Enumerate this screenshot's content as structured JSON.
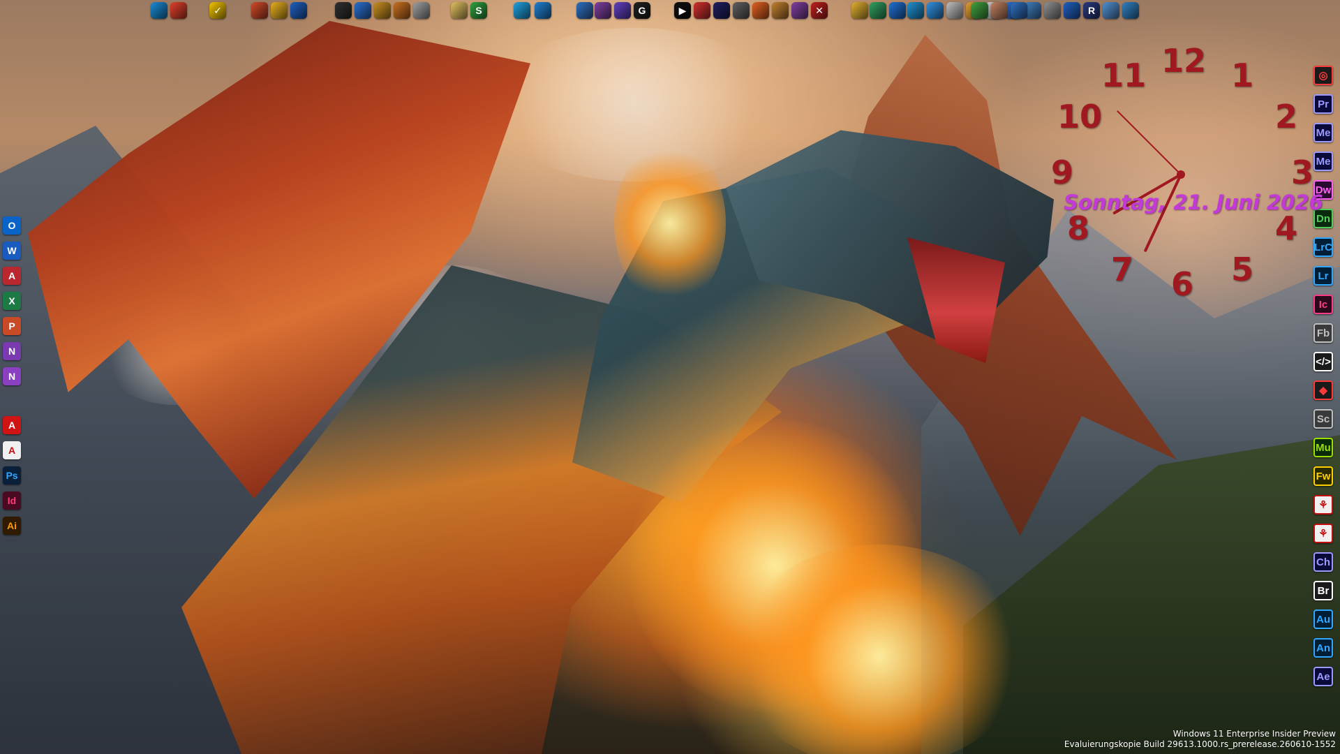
{
  "desktop": {
    "wallpaper_subject": "",
    "watermark": {
      "line1": "Windows 11 Enterprise Insider Preview",
      "line2": "Evaluierungskopie Build 29613.1000.rs_prerelease.260610-1552"
    }
  },
  "clock_widget": {
    "numbers": [
      "12",
      "1",
      "2",
      "3",
      "4",
      "5",
      "6",
      "7",
      "8",
      "9",
      "10",
      "11"
    ],
    "date": "Sonntag, 21. Juni 2026",
    "hour_hand_angle": 240,
    "minute_hand_angle": 205,
    "second_hand_angle": 315,
    "accent_color": "#a01820",
    "date_color": "#c23ad8"
  },
  "top_bar_icons": [
    {
      "name": "edge-icon",
      "label": "",
      "color": "#1a8ad4"
    },
    {
      "name": "chrome-icon",
      "label": "",
      "color": "#e0402a"
    },
    {
      "name": "tasks-icon",
      "label": "✓",
      "color": "#f2c400"
    },
    {
      "name": "app-icon-1",
      "label": "",
      "color": "#d04a2a"
    },
    {
      "name": "app-icon-2",
      "label": "",
      "color": "#e8b020"
    },
    {
      "name": "app-icon-3",
      "label": "",
      "color": "#2060c0"
    },
    {
      "name": "app-icon-4",
      "label": "",
      "color": "#303030"
    },
    {
      "name": "app-icon-5",
      "label": "",
      "color": "#2a70d0"
    },
    {
      "name": "app-icon-6",
      "label": "",
      "color": "#c89020"
    },
    {
      "name": "app-icon-7",
      "label": "",
      "color": "#c87020"
    },
    {
      "name": "app-icon-8",
      "label": "",
      "color": "#a0a0a0"
    },
    {
      "name": "app-icon-9",
      "label": "",
      "color": "#e0c060"
    },
    {
      "name": "app-icon-10",
      "label": "S",
      "color": "#30a040"
    },
    {
      "name": "app-icon-11",
      "label": "",
      "color": "#20a0e0"
    },
    {
      "name": "app-icon-12",
      "label": "",
      "color": "#2080d0"
    },
    {
      "name": "app-icon-13",
      "label": "",
      "color": "#3070c0"
    },
    {
      "name": "app-icon-14",
      "label": "",
      "color": "#8040a0"
    },
    {
      "name": "app-icon-15",
      "label": "",
      "color": "#6040c0"
    },
    {
      "name": "app-icon-16",
      "label": "G",
      "color": "#202020"
    },
    {
      "name": "app-icon-17",
      "label": "▶",
      "color": "#101010"
    },
    {
      "name": "app-icon-18",
      "label": "",
      "color": "#d03030"
    },
    {
      "name": "app-icon-19",
      "label": "",
      "color": "#202060"
    },
    {
      "name": "app-icon-20",
      "label": "",
      "color": "#606060"
    },
    {
      "name": "app-icon-21",
      "label": "",
      "color": "#e06020"
    },
    {
      "name": "app-icon-22",
      "label": "",
      "color": "#c08030"
    },
    {
      "name": "app-icon-23",
      "label": "",
      "color": "#8040a0"
    },
    {
      "name": "app-icon-24",
      "label": "✕",
      "color": "#c02020"
    },
    {
      "name": "app-icon-25",
      "label": "",
      "color": "#e0b030"
    },
    {
      "name": "app-icon-26",
      "label": "",
      "color": "#30a060"
    },
    {
      "name": "app-icon-27",
      "label": "",
      "color": "#2070d0"
    },
    {
      "name": "app-icon-28",
      "label": "",
      "color": "#2090d0"
    },
    {
      "name": "app-icon-29",
      "label": "",
      "color": "#3090e0"
    },
    {
      "name": "app-icon-30",
      "label": "",
      "color": "#c0c0c0"
    },
    {
      "name": "app-icon-31",
      "label": "",
      "color": "#e0a030"
    },
    {
      "name": "app-icon-32",
      "label": "",
      "color": "#d0d0d0"
    },
    {
      "name": "app-icon-33",
      "label": "",
      "color": "#3070d0"
    },
    {
      "name": "app-icon-34",
      "label": "",
      "color": "#4080c0"
    },
    {
      "name": "app-icon-35",
      "label": "",
      "color": "#909090"
    },
    {
      "name": "app-icon-36",
      "label": "",
      "color": "#2060c0"
    },
    {
      "name": "app-icon-37",
      "label": "R",
      "color": "#2a3a80"
    },
    {
      "name": "app-icon-38",
      "label": "",
      "color": "#5090d0"
    },
    {
      "name": "app-icon-39",
      "label": "",
      "color": "#3080c0"
    },
    {
      "name": "app-icon-40",
      "label": "",
      "color": "#40a040"
    },
    {
      "name": "app-icon-41",
      "label": "",
      "color": "#c08060"
    },
    {
      "name": "app-icon-42",
      "label": "",
      "color": "#3070c0"
    }
  ],
  "left_dock": [
    {
      "name": "outlook-icon",
      "label": "O",
      "color": "#0a64c8",
      "fg": "#ffffff"
    },
    {
      "name": "word-icon",
      "label": "W",
      "color": "#1a5bbf",
      "fg": "#ffffff"
    },
    {
      "name": "access-icon",
      "label": "A",
      "color": "#b8282e",
      "fg": "#ffffff"
    },
    {
      "name": "excel-icon",
      "label": "X",
      "color": "#1d7a44",
      "fg": "#ffffff"
    },
    {
      "name": "powerpoint-icon",
      "label": "P",
      "color": "#c84a26",
      "fg": "#ffffff"
    },
    {
      "name": "onenote-icon",
      "label": "N",
      "color": "#7a3bb0",
      "fg": "#ffffff"
    },
    {
      "name": "onenote-2-icon",
      "label": "N",
      "color": "#8a40c0",
      "fg": "#ffffff"
    },
    {
      "name": "acrobat-icon",
      "label": "A",
      "color": "#d01414",
      "fg": "#ffffff"
    },
    {
      "name": "acrobat-reader-icon",
      "label": "A",
      "color": "#f0f0f0",
      "fg": "#c01010"
    },
    {
      "name": "photoshop-icon",
      "label": "Ps",
      "color": "#0a1f3a",
      "fg": "#31a8ff"
    },
    {
      "name": "indesign-icon",
      "label": "Id",
      "color": "#4a0a22",
      "fg": "#ff3b78"
    },
    {
      "name": "illustrator-icon",
      "label": "Ai",
      "color": "#301a00",
      "fg": "#ff9a00"
    }
  ],
  "right_dock": [
    {
      "name": "creative-cloud-icon",
      "label": "◎",
      "color": "#1a1a1a",
      "fg": "#ff3a3a"
    },
    {
      "name": "premiere-icon",
      "label": "Pr",
      "color": "#0a0a3a",
      "fg": "#9a9aff"
    },
    {
      "name": "media-encoder-icon",
      "label": "Me",
      "color": "#0a0a3a",
      "fg": "#9a9aff"
    },
    {
      "name": "media-encoder-2-icon",
      "label": "Me",
      "color": "#0a0a3a",
      "fg": "#9a9aff"
    },
    {
      "name": "dreamweaver-icon",
      "label": "Dw",
      "color": "#2a0a2e",
      "fg": "#ff61f6"
    },
    {
      "name": "dimension-icon",
      "label": "Dn",
      "color": "#0a2a10",
      "fg": "#4fcf5a"
    },
    {
      "name": "lightroom-classic-icon",
      "label": "LrC",
      "color": "#001e36",
      "fg": "#31a8ff"
    },
    {
      "name": "lightroom-icon",
      "label": "Lr",
      "color": "#001e36",
      "fg": "#31a8ff"
    },
    {
      "name": "incopy-icon",
      "label": "Ic",
      "color": "#2a0a1a",
      "fg": "#ff3b8a"
    },
    {
      "name": "flash-builder-icon",
      "label": "Fb",
      "color": "#3a3a3a",
      "fg": "#c0c0c0"
    },
    {
      "name": "code-icon",
      "label": "</>",
      "color": "#1a1a1a",
      "fg": "#ffffff"
    },
    {
      "name": "substance-icon",
      "label": "◆",
      "color": "#1a1a1a",
      "fg": "#ff3a3a"
    },
    {
      "name": "scout-icon",
      "label": "Sc",
      "color": "#3a3a3a",
      "fg": "#c0c0c0"
    },
    {
      "name": "muse-icon",
      "label": "Mu",
      "color": "#0a2a0a",
      "fg": "#9ae000"
    },
    {
      "name": "fireworks-icon",
      "label": "Fw",
      "color": "#2a2a00",
      "fg": "#ffd000"
    },
    {
      "name": "acrobat-pro-icon",
      "label": "⚘",
      "color": "#f0f0f0",
      "fg": "#c01010"
    },
    {
      "name": "acrobat-dc-icon",
      "label": "⚘",
      "color": "#f0f0f0",
      "fg": "#c01010"
    },
    {
      "name": "character-animator-icon",
      "label": "Ch",
      "color": "#0a0a3a",
      "fg": "#9a9aff"
    },
    {
      "name": "bridge-icon",
      "label": "Br",
      "color": "#1a1a1a",
      "fg": "#ffffff"
    },
    {
      "name": "audition-icon",
      "label": "Au",
      "color": "#001e36",
      "fg": "#31a8ff"
    },
    {
      "name": "animate-icon",
      "label": "An",
      "color": "#001e36",
      "fg": "#31a8ff"
    },
    {
      "name": "after-effects-icon",
      "label": "Ae",
      "color": "#0a0a3a",
      "fg": "#9a9aff"
    }
  ]
}
